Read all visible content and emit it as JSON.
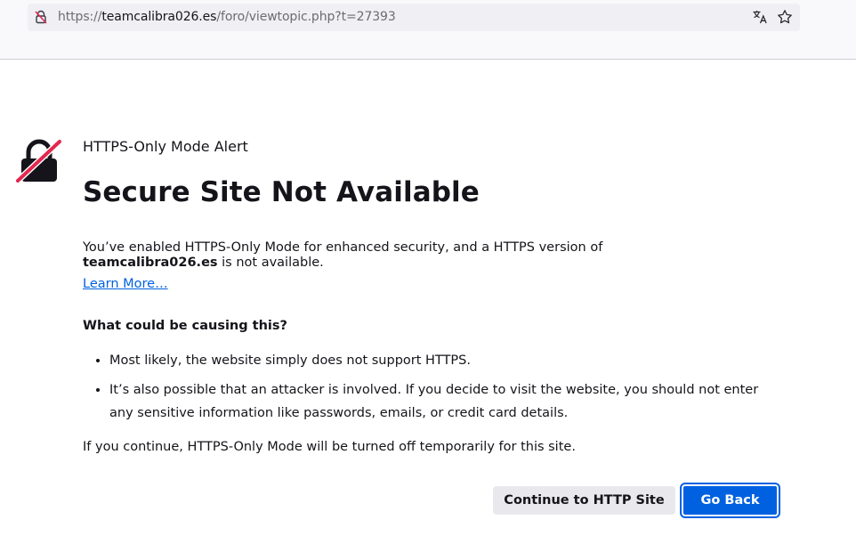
{
  "urlbar": {
    "scheme": "https://",
    "host": "teamcalibra026.es",
    "path": "/foro/viewtopic.php?t=27393"
  },
  "icons": {
    "url_lock": "insecure-lock-icon",
    "translate": "translate-icon",
    "bookmark": "star-icon",
    "alert": "broken-lock-icon"
  },
  "colors": {
    "accent": "#0061e0",
    "alert_slash": "#e22850",
    "toolbar_bg": "#f9f9fb",
    "urlbar_bg": "#f0f0f4"
  },
  "alert": {
    "label": "HTTPS-Only Mode Alert",
    "title": "Secure Site Not Available",
    "desc_before": "You’ve enabled HTTPS-Only Mode for enhanced security, and a HTTPS version of ",
    "desc_host": "teamcalibra026.es",
    "desc_after": " is not available.",
    "learn_more": "Learn More…",
    "cause_heading": "What could be causing this?",
    "causes": [
      "Most likely, the website simply does not support HTTPS.",
      "It’s also possible that an attacker is involved. If you decide to visit the website, you should not enter any sensitive information like passwords, emails, or credit card details."
    ],
    "continue_note": "If you continue, HTTPS-Only Mode will be turned off temporarily for this site."
  },
  "buttons": {
    "continue": "Continue to HTTP Site",
    "back": "Go Back"
  }
}
